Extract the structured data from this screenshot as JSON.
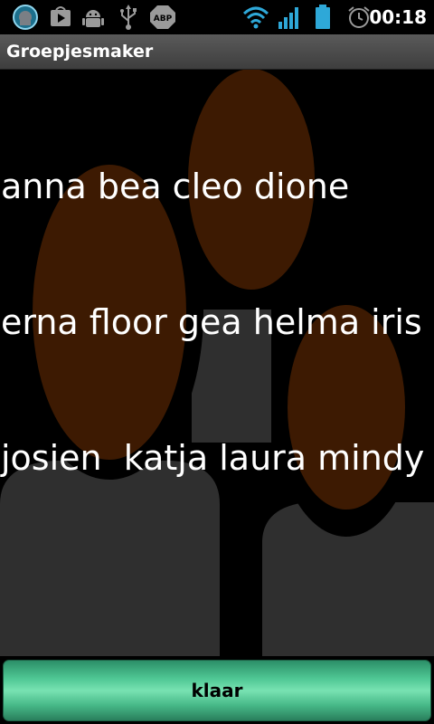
{
  "status_bar": {
    "time": "00:18",
    "left_icons": [
      "app-badge-icon",
      "play-store-icon",
      "android-debug-icon",
      "usb-icon",
      "adblock-icon"
    ],
    "adblock_text": "ABP",
    "right_icons": [
      "wifi-icon",
      "signal-icon",
      "battery-icon",
      "alarm-icon"
    ]
  },
  "app": {
    "title": "Groepjesmaker"
  },
  "names": {
    "lines": [
      "anna bea cleo dione",
      "erna floor gea helma iris",
      "josien  katja laura mindy"
    ]
  },
  "actions": {
    "done_label": "klaar"
  },
  "colors": {
    "background": "#000000",
    "figure_head": "#3d1a02",
    "figure_body": "#2f2f2f",
    "button": "#4fc794",
    "text": "#ffffff"
  }
}
